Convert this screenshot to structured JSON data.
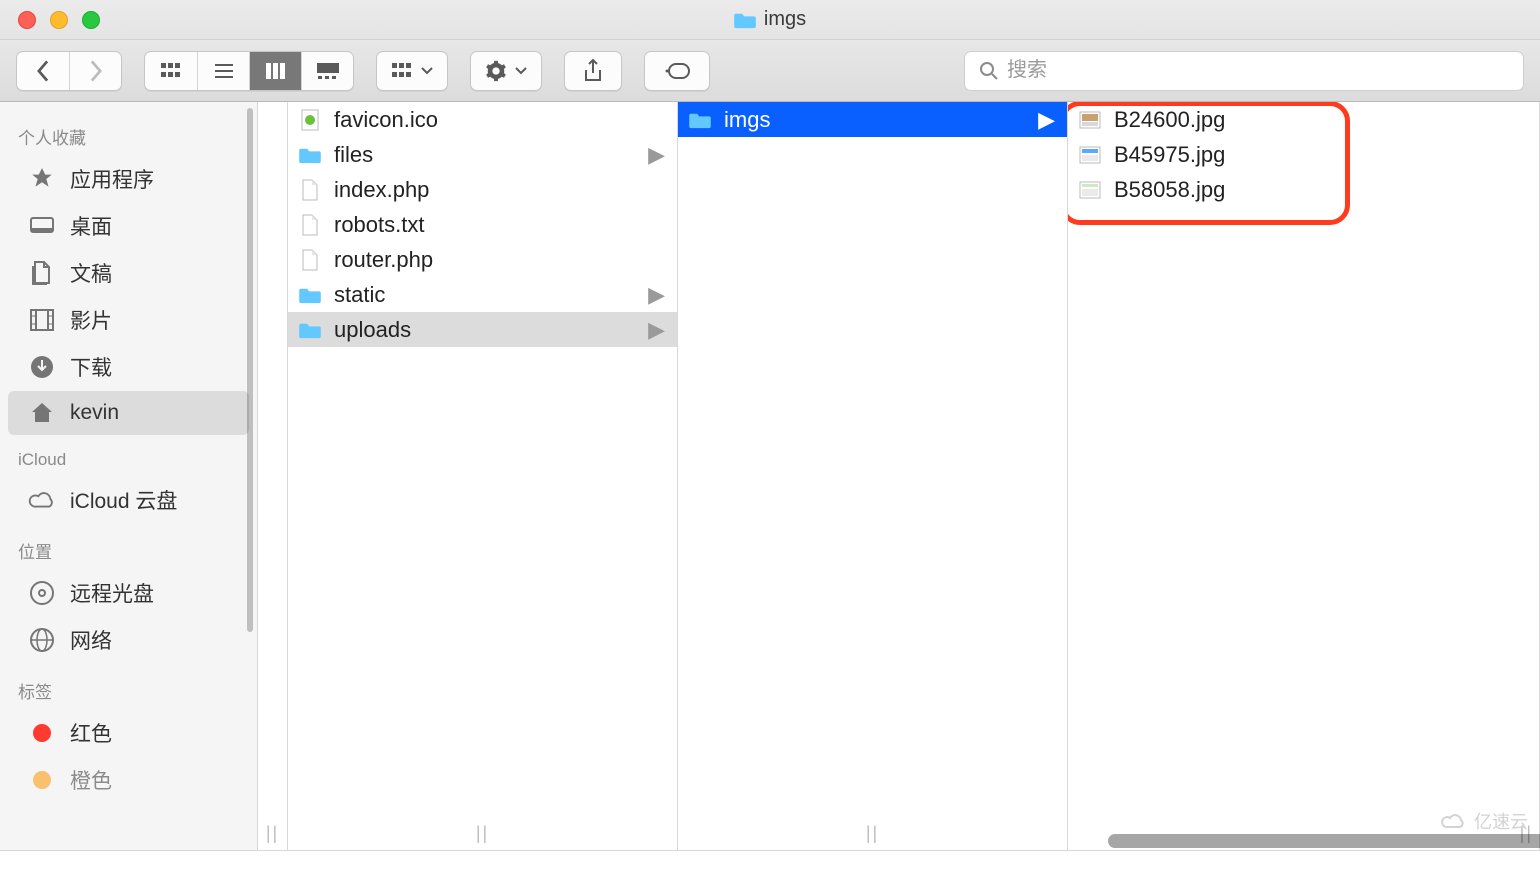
{
  "window": {
    "title": "imgs"
  },
  "search": {
    "placeholder": "搜索"
  },
  "sidebar": {
    "sections": [
      {
        "label": "个人收藏",
        "items": [
          {
            "icon": "apps",
            "label": "应用程序"
          },
          {
            "icon": "desktop",
            "label": "桌面"
          },
          {
            "icon": "docs",
            "label": "文稿"
          },
          {
            "icon": "movies",
            "label": "影片"
          },
          {
            "icon": "downloads",
            "label": "下载"
          },
          {
            "icon": "home",
            "label": "kevin",
            "active": true
          }
        ]
      },
      {
        "label": "iCloud",
        "items": [
          {
            "icon": "cloud",
            "label": "iCloud 云盘"
          }
        ]
      },
      {
        "label": "位置",
        "items": [
          {
            "icon": "disc",
            "label": "远程光盘"
          },
          {
            "icon": "globe",
            "label": "网络"
          }
        ]
      },
      {
        "label": "标签",
        "items": [
          {
            "icon": "tag",
            "color": "#ff3b30",
            "label": "红色"
          },
          {
            "icon": "tag",
            "color": "#ff9500",
            "label": "橙色"
          }
        ]
      }
    ]
  },
  "columns": {
    "c1": [
      {
        "name": "favicon.ico",
        "type": "file-ico"
      },
      {
        "name": "files",
        "type": "folder",
        "hasChildren": true
      },
      {
        "name": "index.php",
        "type": "file"
      },
      {
        "name": "robots.txt",
        "type": "file"
      },
      {
        "name": "router.php",
        "type": "file"
      },
      {
        "name": "static",
        "type": "folder",
        "hasChildren": true
      },
      {
        "name": "uploads",
        "type": "folder",
        "hasChildren": true,
        "selected": true
      }
    ],
    "c2": [
      {
        "name": "imgs",
        "type": "folder",
        "hasChildren": true,
        "selected": true
      }
    ],
    "c3": [
      {
        "name": "B24600.jpg",
        "type": "image"
      },
      {
        "name": "B45975.jpg",
        "type": "image"
      },
      {
        "name": "B58058.jpg",
        "type": "image"
      }
    ]
  },
  "watermark": "亿速云"
}
